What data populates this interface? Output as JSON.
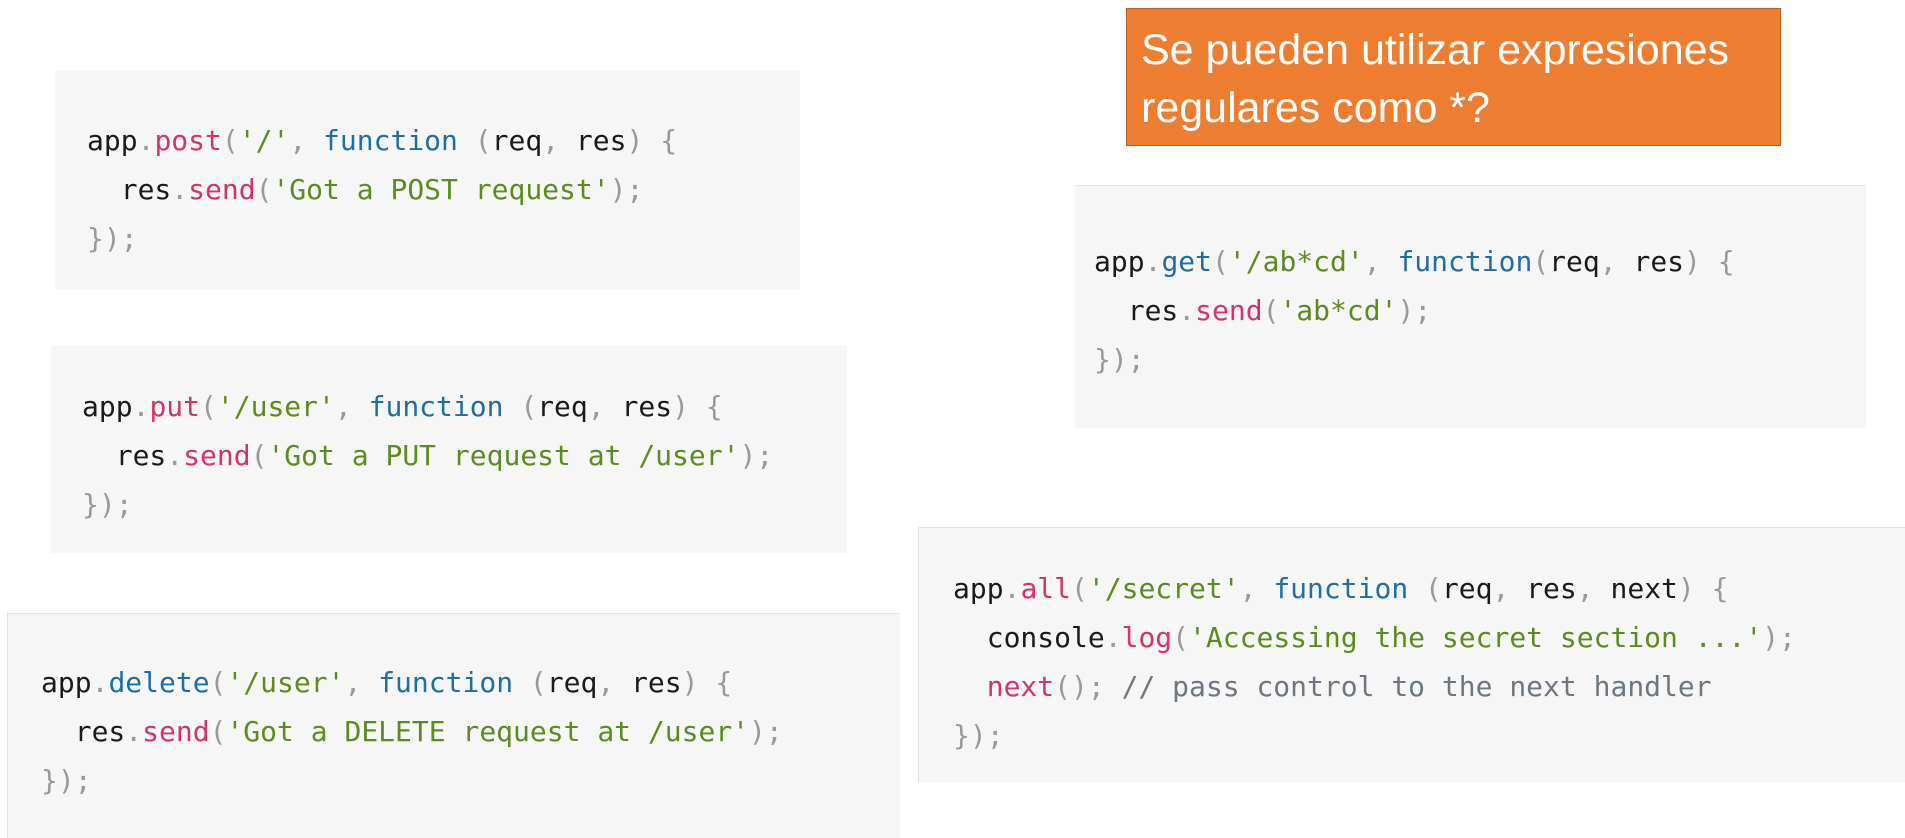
{
  "callout": {
    "line1": "Se pueden utilizar expresiones",
    "line2": "regulares como *?"
  },
  "post_block": {
    "obj": "app",
    "method": "post",
    "route": "'/'",
    "keyword": "function",
    "param1": "req",
    "param2": "res",
    "body_obj": "res",
    "body_method": "send",
    "body_arg": "'Got a POST request'"
  },
  "put_block": {
    "obj": "app",
    "method": "put",
    "route": "'/user'",
    "keyword": "function",
    "param1": "req",
    "param2": "res",
    "body_obj": "res",
    "body_method": "send",
    "body_arg": "'Got a PUT request at /user'"
  },
  "delete_block": {
    "obj": "app",
    "method": "delete",
    "route": "'/user'",
    "keyword": "function",
    "param1": "req",
    "param2": "res",
    "body_obj": "res",
    "body_method": "send",
    "body_arg": "'Got a DELETE request at /user'"
  },
  "get_block": {
    "obj": "app",
    "method": "get",
    "route": "'/ab*cd'",
    "keyword": "function",
    "param1": "req",
    "param2": "res",
    "body_obj": "res",
    "body_method": "send",
    "body_arg": "'ab*cd'"
  },
  "all_block": {
    "obj": "app",
    "method": "all",
    "route": "'/secret'",
    "keyword": "function",
    "param1": "req",
    "param2": "res",
    "param3": "next",
    "body_obj": "console",
    "body_method": "log",
    "body_arg": "'Accessing the secret section ...'",
    "next_call": "next",
    "comment": "// pass control to the next handler"
  }
}
